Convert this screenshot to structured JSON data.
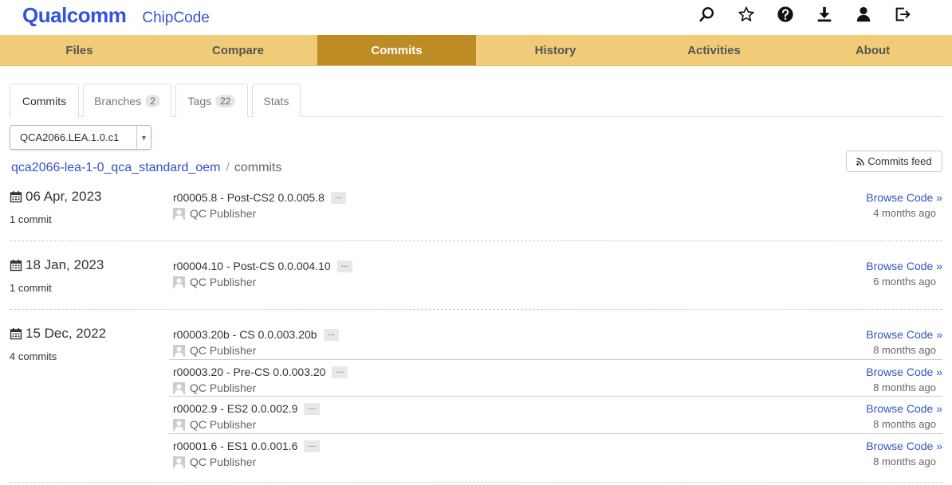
{
  "header": {
    "logo": "Qualcomm",
    "product": "ChipCode",
    "icons": [
      "search-icon",
      "star-icon",
      "help-icon",
      "download-icon",
      "user-icon",
      "logout-icon"
    ]
  },
  "nav": {
    "items": [
      "Files",
      "Compare",
      "Commits",
      "History",
      "Activities",
      "About"
    ],
    "active": "Commits"
  },
  "subtabs": {
    "commits": "Commits",
    "branches": "Branches",
    "branches_count": "2",
    "tags": "Tags",
    "tags_count": "22",
    "stats": "Stats"
  },
  "branch_select": {
    "value": "QCA2066.LEA.1.0.c1"
  },
  "breadcrumb": {
    "repo": "qca2066-lea-1-0_qca_standard_oem",
    "separator": "/",
    "current": "commits"
  },
  "feed_button": "Commits feed",
  "days": [
    {
      "date": "06 Apr, 2023",
      "count": "1 commit",
      "commits": [
        {
          "title": "r00005.8 - Post-CS2 0.0.005.8",
          "more": "...",
          "author": "QC Publisher",
          "browse": "Browse Code »",
          "age": "4 months ago"
        }
      ]
    },
    {
      "date": "18 Jan, 2023",
      "count": "1 commit",
      "commits": [
        {
          "title": "r00004.10 - Post-CS 0.0.004.10",
          "more": "...",
          "author": "QC Publisher",
          "browse": "Browse Code »",
          "age": "6 months ago"
        }
      ]
    },
    {
      "date": "15 Dec, 2022",
      "count": "4 commits",
      "commits": [
        {
          "title": "r00003.20b - CS 0.0.003.20b",
          "more": "...",
          "author": "QC Publisher",
          "browse": "Browse Code »",
          "age": "8 months ago"
        },
        {
          "title": "r00003.20 - Pre-CS 0.0.003.20",
          "more": "...",
          "author": "QC Publisher",
          "browse": "Browse Code »",
          "age": "8 months ago"
        },
        {
          "title": "r00002.9 - ES2 0.0.002.9",
          "more": "...",
          "author": "QC Publisher",
          "browse": "Browse Code »",
          "age": "8 months ago"
        },
        {
          "title": "r00001.6 - ES1 0.0.001.6",
          "more": "...",
          "author": "QC Publisher",
          "browse": "Browse Code »",
          "age": "8 months ago"
        }
      ]
    }
  ]
}
